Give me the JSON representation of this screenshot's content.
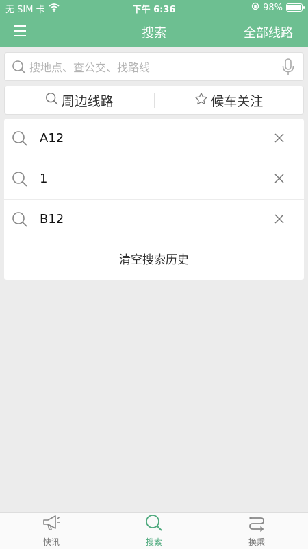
{
  "status_bar": {
    "carrier": "无 SIM 卡",
    "time": "下午 6:36",
    "battery_percent": "98%",
    "battery_level": 0.98
  },
  "nav": {
    "title": "搜索",
    "right_label": "全部线路"
  },
  "search": {
    "placeholder": "搜地点、查公交、找路线",
    "value": ""
  },
  "quick_actions": [
    {
      "label": "周边线路",
      "icon": "search-icon"
    },
    {
      "label": "候车关注",
      "icon": "star-icon"
    }
  ],
  "history": {
    "items": [
      {
        "text": "A12"
      },
      {
        "text": "1"
      },
      {
        "text": "B12"
      }
    ],
    "clear_label": "清空搜索历史"
  },
  "tabs": [
    {
      "label": "快讯",
      "icon": "megaphone-icon",
      "active": false
    },
    {
      "label": "搜索",
      "icon": "search-icon",
      "active": true
    },
    {
      "label": "换乘",
      "icon": "transfer-icon",
      "active": false
    }
  ],
  "colors": {
    "brand_green": "#6dbf91",
    "active_tab": "#4faa7e",
    "background": "#ececec"
  }
}
